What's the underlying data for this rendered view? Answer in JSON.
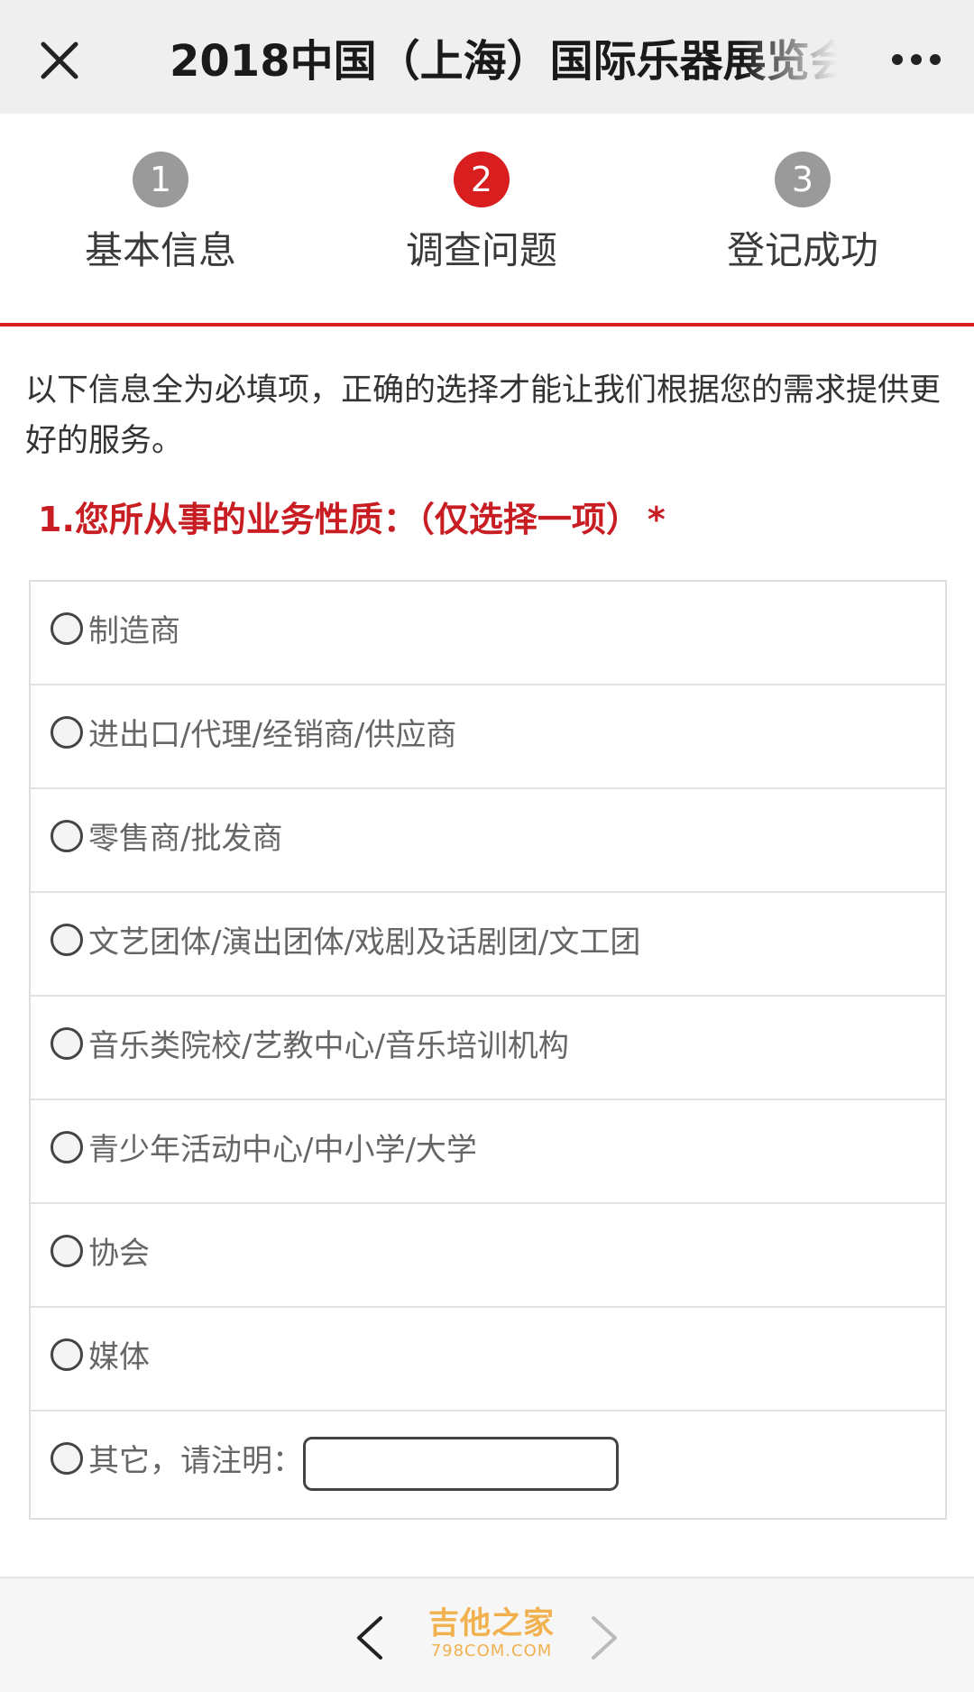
{
  "header": {
    "title": "2018中国（上海）国际乐器展览会",
    "close_icon": "close-icon",
    "more_icon": "more-dots-icon"
  },
  "steps": [
    {
      "number": "1",
      "label": "基本信息",
      "state": "done"
    },
    {
      "number": "2",
      "label": "调查问题",
      "state": "active"
    },
    {
      "number": "3",
      "label": "登记成功",
      "state": "pending"
    }
  ],
  "intro": "以下信息全为必填项，正确的选择才能让我们根据您的需求提供更好的服务。",
  "question": {
    "title": "1.您所从事的业务性质：（仅选择一项）",
    "required_mark": "*"
  },
  "options": [
    {
      "label": "制造商"
    },
    {
      "label": "进出口/代理/经销商/供应商"
    },
    {
      "label": "零售商/批发商"
    },
    {
      "label": "文艺团体/演出团体/戏剧及话剧团/文工团"
    },
    {
      "label": "音乐类院校/艺教中心/音乐培训机构"
    },
    {
      "label": "青少年活动中心/中小学/大学"
    },
    {
      "label": "协会"
    },
    {
      "label": "媒体"
    },
    {
      "label": "其它，请注明：",
      "other_value": ""
    }
  ],
  "footer": {
    "back_icon": "chevron-left-icon",
    "forward_icon": "chevron-right-icon",
    "watermark_main": "吉他之家",
    "watermark_sub": "798COM.COM"
  },
  "colors": {
    "accent": "#d81e1e",
    "question": "#c81e23",
    "step_inactive": "#9a9a9a",
    "watermark": "#f0a531"
  }
}
